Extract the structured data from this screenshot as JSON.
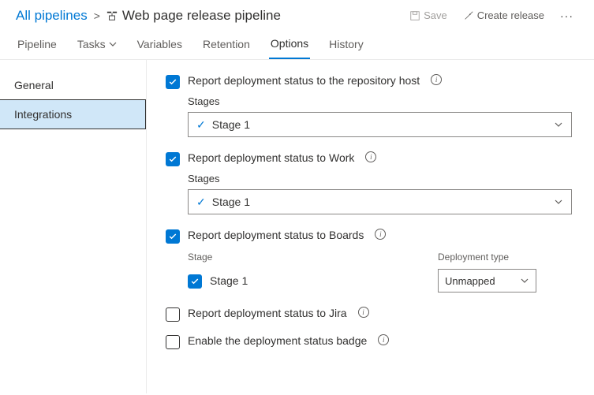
{
  "breadcrumb": {
    "root": "All pipelines",
    "title": "Web page release pipeline"
  },
  "toolbar": {
    "save": "Save",
    "create_release": "Create release"
  },
  "tabs": {
    "pipeline": "Pipeline",
    "tasks": "Tasks",
    "variables": "Variables",
    "retention": "Retention",
    "options": "Options",
    "history": "History"
  },
  "sidebar": {
    "general": "General",
    "integrations": "Integrations"
  },
  "opts": {
    "repo": {
      "label": "Report deployment status to the repository host",
      "stages_label": "Stages",
      "stage_value": "Stage 1"
    },
    "work": {
      "label": "Report deployment status to Work",
      "stages_label": "Stages",
      "stage_value": "Stage 1"
    },
    "boards": {
      "label": "Report deployment status to Boards",
      "col_stage": "Stage",
      "col_deploy": "Deployment type",
      "stage_value": "Stage 1",
      "deploy_type": "Unmapped"
    },
    "jira": {
      "label": "Report deployment status to Jira"
    },
    "badge": {
      "label": "Enable the deployment status badge"
    }
  }
}
